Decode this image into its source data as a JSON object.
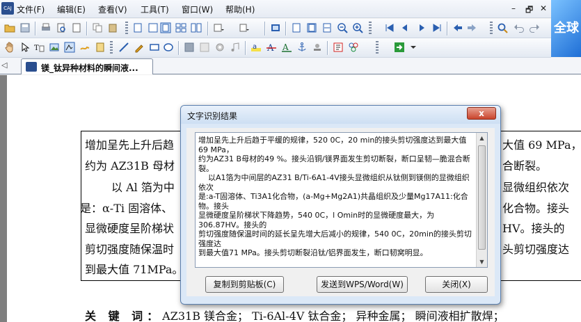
{
  "app": {
    "icon_label": "CAJ",
    "menu": [
      "文件(F)",
      "编辑(E)",
      "查看(V)",
      "工具(T)",
      "窗口(W)",
      "帮助(H)"
    ],
    "window_controls": [
      "–",
      "🗗",
      "✕"
    ],
    "brand_text": "全球"
  },
  "tab": {
    "label": "镁_钛异种材料的瞬间液..."
  },
  "document": {
    "lines": [
      "增加呈先上升后趋",
      "约为 AZ31B 母材",
      "以 Al 箔为中",
      "是：α-Ti 固溶体、",
      "显微硬度呈阶梯状",
      "剪切强度随保温时",
      "到最大值 71MPa。"
    ],
    "right_fragments": [
      "大值 69 MPa，",
      "合断裂。",
      "显微组织依次",
      "化合物。接头",
      "HV。接头的",
      "头剪切强度达"
    ],
    "keywords_label": "关 键 词：",
    "keywords": "AZ31B 镁合金；  Ti-6Al-4V 钛合金；  异种金属；  瞬间液相扩散焊；"
  },
  "dialog": {
    "title": "文字识别结果",
    "close_symbol": "x",
    "text": "增加呈先上升后趋于平缓的规律，520 0C，20 min的接头剪切强度达到最大值69 MPa，\n约为AZ31 B母材的49 %。接头沿铜/镁界面发生剪切断裂，断口呈韧—脆混合断裂。\n    以A1箔为中间层的AZ31 B/Ti-6A1-4V接头显微组织从钛侧到镁侧的显微组织依次\n是:a-T固溶体、Ti3A1化合物，(a-Mg+Mg2A1)共晶组织及少量Mg17A11:化合物。接头\n显微硬度呈阶梯状下降趋势，540 0C，l Omin时的显微硬度最大，为306.87HV。接头的\n剪切强度随保温时间的延长呈先增大后减小的规律，540 0C，20min的接头剪切强度达\n到最大值71 MPa。接头剪切断裂沿钛/铝界面发生，断口韧窝明显。",
    "buttons": {
      "copy": "复制到剪贴板(C)",
      "send": "发送到WPS/Word(W)",
      "close": "关闭(X)"
    }
  }
}
